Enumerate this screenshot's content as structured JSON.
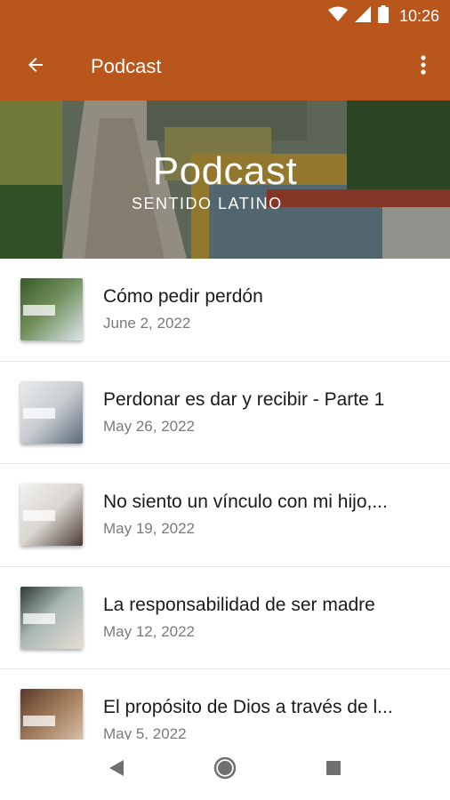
{
  "status_bar": {
    "time": "10:26"
  },
  "app_bar": {
    "title": "Podcast"
  },
  "banner": {
    "title": "Podcast",
    "subtitle": "SENTIDO LATINO"
  },
  "episodes": [
    {
      "title": "Cómo pedir perdón",
      "date": "June 2, 2022"
    },
    {
      "title": "Perdonar es dar y recibir - Parte 1",
      "date": "May 26, 2022"
    },
    {
      "title": "No siento un vínculo con mi hijo,...",
      "date": "May 19, 2022"
    },
    {
      "title": "La responsabilidad de ser madre",
      "date": "May 12, 2022"
    },
    {
      "title": "El propósito de Dios a través de l...",
      "date": "May 5, 2022"
    }
  ],
  "colors": {
    "app_bar": "#b8561b",
    "title_text": "#1a1a1a",
    "date_text": "#7a7a7a"
  },
  "icons": [
    "wifi-icon",
    "signal-icon",
    "battery-icon",
    "back-arrow-icon",
    "more-vert-icon",
    "nav-back-icon",
    "nav-home-icon",
    "nav-recents-icon"
  ]
}
